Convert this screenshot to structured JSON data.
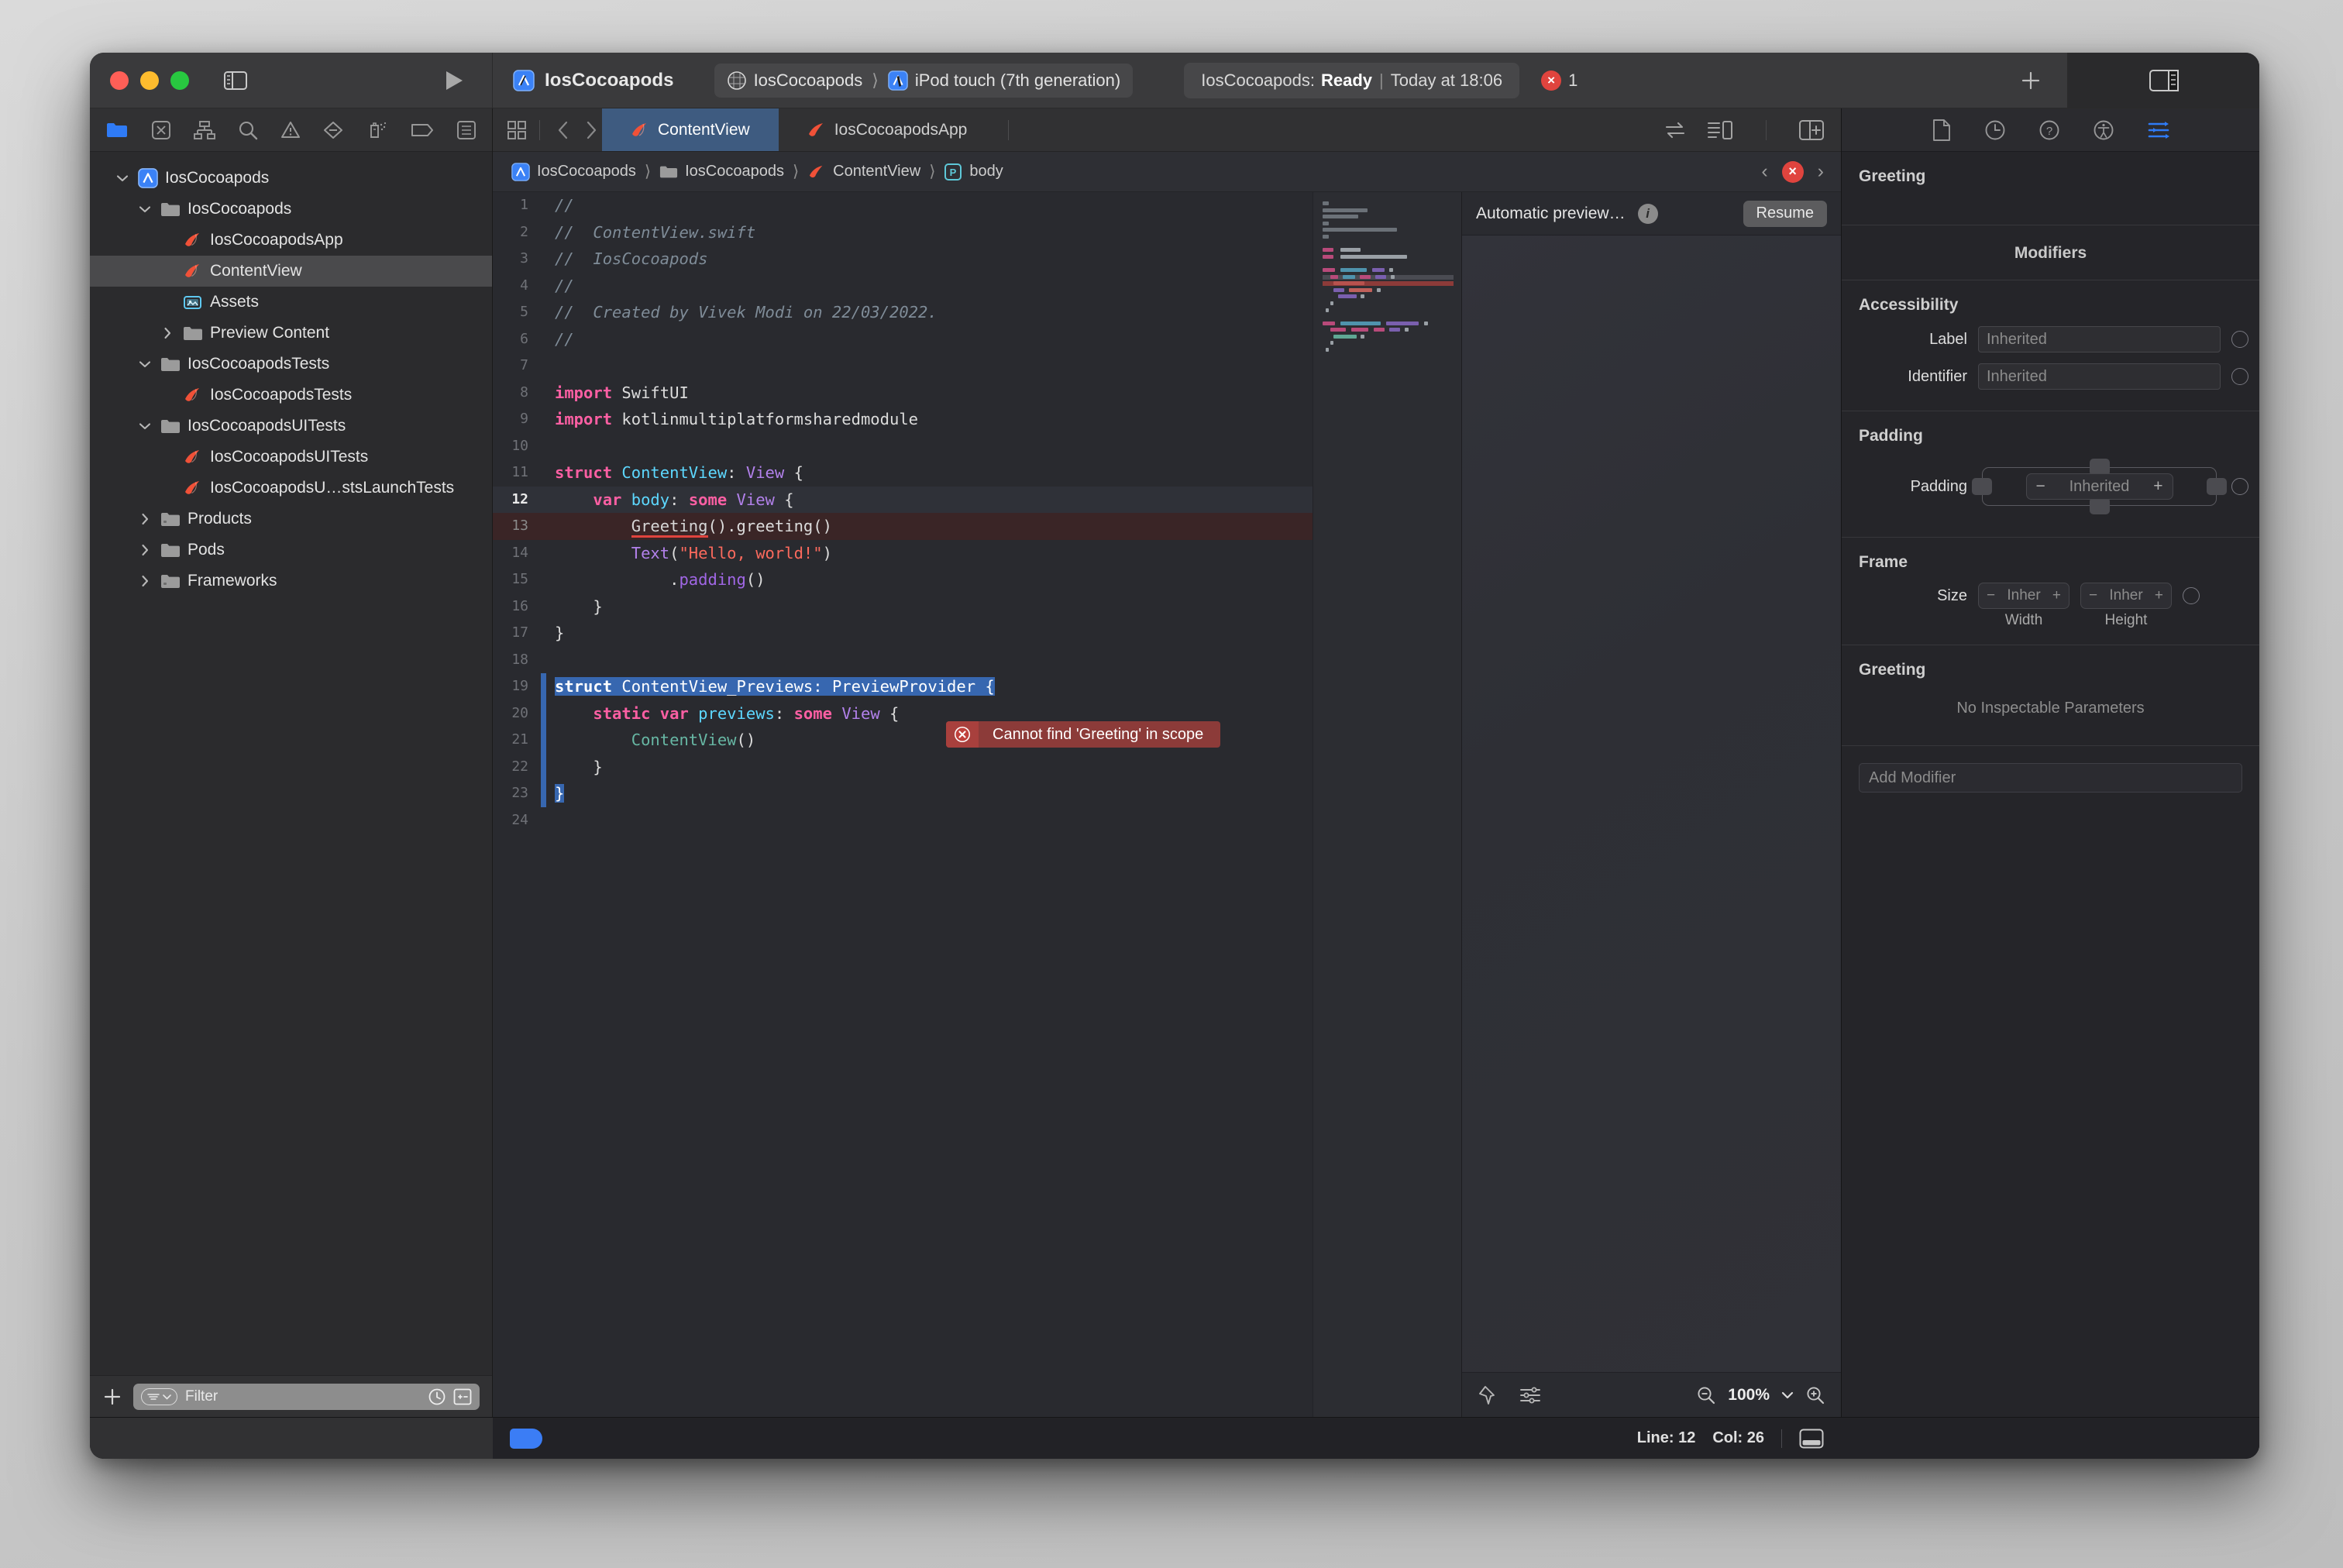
{
  "window": {
    "traffic_lights": [
      "close",
      "minimize",
      "zoom"
    ]
  },
  "toolbar": {
    "project_name": "IosCocoapods",
    "scheme_name": "IosCocoapods",
    "destination": "iPod touch (7th generation)",
    "status_project": "IosCocoapods:",
    "status_state": "Ready",
    "status_divider": "|",
    "status_time": "Today at 18:06",
    "error_count": "1",
    "error_badge_glyph": "×",
    "add_button_glyph": "+"
  },
  "navigator": {
    "icon_bar": [
      {
        "name": "project-navigator-icon",
        "active": true
      },
      {
        "name": "source-control-navigator-icon",
        "active": false
      },
      {
        "name": "symbol-navigator-icon",
        "active": false
      },
      {
        "name": "find-navigator-icon",
        "active": false
      },
      {
        "name": "issue-navigator-icon",
        "active": false
      },
      {
        "name": "test-navigator-icon",
        "active": false
      },
      {
        "name": "debug-navigator-icon",
        "active": false
      },
      {
        "name": "breakpoint-navigator-icon",
        "active": false
      },
      {
        "name": "report-navigator-icon",
        "active": false
      }
    ],
    "tree": [
      {
        "label": "IosCocoapods",
        "indent": 0,
        "twisty": "down",
        "icon": "xcode-project-icon",
        "selected": false
      },
      {
        "label": "IosCocoapods",
        "indent": 1,
        "twisty": "down",
        "icon": "folder-icon",
        "selected": false
      },
      {
        "label": "IosCocoapodsApp",
        "indent": 2,
        "twisty": "none",
        "icon": "swift-file-icon",
        "selected": false
      },
      {
        "label": "ContentView",
        "indent": 2,
        "twisty": "none",
        "icon": "swift-file-icon",
        "selected": true
      },
      {
        "label": "Assets",
        "indent": 2,
        "twisty": "none",
        "icon": "assets-catalog-icon",
        "selected": false
      },
      {
        "label": "Preview Content",
        "indent": 2,
        "twisty": "right",
        "icon": "folder-icon",
        "selected": false
      },
      {
        "label": "IosCocoapodsTests",
        "indent": 1,
        "twisty": "down",
        "icon": "folder-icon",
        "selected": false
      },
      {
        "label": "IosCocoapodsTests",
        "indent": 2,
        "twisty": "none",
        "icon": "swift-file-icon",
        "selected": false
      },
      {
        "label": "IosCocoapodsUITests",
        "indent": 1,
        "twisty": "down",
        "icon": "folder-icon",
        "selected": false
      },
      {
        "label": "IosCocoapodsUITests",
        "indent": 2,
        "twisty": "none",
        "icon": "swift-file-icon",
        "selected": false
      },
      {
        "label": "IosCocoapodsU…stsLaunchTests",
        "indent": 2,
        "twisty": "none",
        "icon": "swift-file-icon",
        "selected": false
      },
      {
        "label": "Products",
        "indent": 1,
        "twisty": "right",
        "icon": "group-folder-icon",
        "selected": false
      },
      {
        "label": "Pods",
        "indent": 1,
        "twisty": "right",
        "icon": "folder-icon",
        "selected": false
      },
      {
        "label": "Frameworks",
        "indent": 1,
        "twisty": "right",
        "icon": "group-folder-icon",
        "selected": false
      }
    ],
    "footer": {
      "add_glyph": "+",
      "filter_placeholder": "Filter"
    }
  },
  "editor": {
    "tabs": [
      {
        "label": "ContentView",
        "active": true
      },
      {
        "label": "IosCocoapodsApp",
        "active": false
      }
    ],
    "breadcrumb": [
      {
        "label": "IosCocoapods",
        "icon": "xcode-project-icon"
      },
      {
        "label": "IosCocoapods",
        "icon": "folder-icon"
      },
      {
        "label": "ContentView",
        "icon": "swift-file-icon"
      },
      {
        "label": "body",
        "icon": "property-icon"
      }
    ],
    "breadcrumb_sep": "›",
    "issue_nav": {
      "prev": "‹",
      "next": "›",
      "badge": "×"
    },
    "code_lines": [
      {
        "n": "1",
        "cur": false,
        "err": false,
        "tokens": [
          {
            "c": "cm",
            "t": "//"
          }
        ]
      },
      {
        "n": "2",
        "cur": false,
        "err": false,
        "tokens": [
          {
            "c": "cm",
            "t": "//  ContentView.swift"
          }
        ]
      },
      {
        "n": "3",
        "cur": false,
        "err": false,
        "tokens": [
          {
            "c": "cm",
            "t": "//  IosCocoapods"
          }
        ]
      },
      {
        "n": "4",
        "cur": false,
        "err": false,
        "tokens": [
          {
            "c": "cm",
            "t": "//"
          }
        ]
      },
      {
        "n": "5",
        "cur": false,
        "err": false,
        "tokens": [
          {
            "c": "cm",
            "t": "//  Created by Vivek Modi on 22/03/2022."
          }
        ]
      },
      {
        "n": "6",
        "cur": false,
        "err": false,
        "tokens": [
          {
            "c": "cm",
            "t": "//"
          }
        ]
      },
      {
        "n": "7",
        "cur": false,
        "err": false,
        "tokens": []
      },
      {
        "n": "8",
        "cur": false,
        "err": false,
        "tokens": [
          {
            "c": "k",
            "t": "import"
          },
          {
            "c": "plain",
            "t": " SwiftUI"
          }
        ]
      },
      {
        "n": "9",
        "cur": false,
        "err": false,
        "tokens": [
          {
            "c": "k",
            "t": "import"
          },
          {
            "c": "plain",
            "t": " kotlinmultiplatformsharedmodule"
          }
        ]
      },
      {
        "n": "10",
        "cur": false,
        "err": false,
        "tokens": []
      },
      {
        "n": "11",
        "cur": false,
        "err": false,
        "tokens": [
          {
            "c": "k",
            "t": "struct"
          },
          {
            "c": "plain",
            "t": " "
          },
          {
            "c": "t",
            "t": "ContentView"
          },
          {
            "c": "plain",
            "t": ": "
          },
          {
            "c": "ty",
            "t": "View"
          },
          {
            "c": "plain",
            "t": " {"
          }
        ]
      },
      {
        "n": "12",
        "cur": true,
        "err": false,
        "tokens": [
          {
            "c": "plain",
            "t": "    "
          },
          {
            "c": "k",
            "t": "var"
          },
          {
            "c": "plain",
            "t": " "
          },
          {
            "c": "t",
            "t": "body"
          },
          {
            "c": "plain",
            "t": ": "
          },
          {
            "c": "k",
            "t": "some"
          },
          {
            "c": "plain",
            "t": " "
          },
          {
            "c": "ty",
            "t": "View"
          },
          {
            "c": "plain",
            "t": " {"
          }
        ]
      },
      {
        "n": "13",
        "cur": false,
        "err": true,
        "tokens": [
          {
            "c": "plain",
            "t": "        "
          },
          {
            "c": "squiggle",
            "t": "Greeting"
          },
          {
            "c": "plain",
            "t": "().greeting()"
          }
        ]
      },
      {
        "n": "14",
        "cur": false,
        "err": false,
        "tokens": [
          {
            "c": "plain",
            "t": "        "
          },
          {
            "c": "ty",
            "t": "Text"
          },
          {
            "c": "plain",
            "t": "("
          },
          {
            "c": "str",
            "t": "\"Hello, world!\""
          },
          {
            "c": "plain",
            "t": ")"
          }
        ]
      },
      {
        "n": "15",
        "cur": false,
        "err": false,
        "tokens": [
          {
            "c": "plain",
            "t": "            ."
          },
          {
            "c": "met",
            "t": "padding"
          },
          {
            "c": "plain",
            "t": "()"
          }
        ]
      },
      {
        "n": "16",
        "cur": false,
        "err": false,
        "tokens": [
          {
            "c": "plain",
            "t": "    }"
          }
        ]
      },
      {
        "n": "17",
        "cur": false,
        "err": false,
        "tokens": [
          {
            "c": "plain",
            "t": "}"
          }
        ]
      },
      {
        "n": "18",
        "cur": false,
        "err": false,
        "tokens": []
      },
      {
        "n": "19",
        "cur": false,
        "err": false,
        "selected": true,
        "tokens": [
          {
            "c": "k sel",
            "t": "struct"
          },
          {
            "c": "sel",
            "t": " "
          },
          {
            "c": "sel",
            "t": "ContentView_Previews"
          },
          {
            "c": "sel",
            "t": ": "
          },
          {
            "c": "sel",
            "t": "PreviewProvider"
          },
          {
            "c": "sel",
            "t": " {"
          }
        ]
      },
      {
        "n": "20",
        "cur": false,
        "err": false,
        "tokens": [
          {
            "c": "plain",
            "t": "    "
          },
          {
            "c": "k",
            "t": "static"
          },
          {
            "c": "plain",
            "t": " "
          },
          {
            "c": "k",
            "t": "var"
          },
          {
            "c": "plain",
            "t": " "
          },
          {
            "c": "t",
            "t": "previews"
          },
          {
            "c": "plain",
            "t": ": "
          },
          {
            "c": "k",
            "t": "some"
          },
          {
            "c": "plain",
            "t": " "
          },
          {
            "c": "ty",
            "t": "View"
          },
          {
            "c": "plain",
            "t": " {"
          }
        ]
      },
      {
        "n": "21",
        "cur": false,
        "err": false,
        "tokens": [
          {
            "c": "plain",
            "t": "        "
          },
          {
            "c": "gt",
            "t": "ContentView"
          },
          {
            "c": "plain",
            "t": "()"
          }
        ]
      },
      {
        "n": "22",
        "cur": false,
        "err": false,
        "tokens": [
          {
            "c": "plain",
            "t": "    }"
          }
        ]
      },
      {
        "n": "23",
        "cur": false,
        "err": false,
        "selected_end": true,
        "tokens": [
          {
            "c": "sel",
            "t": "}"
          }
        ]
      },
      {
        "n": "24",
        "cur": false,
        "err": false,
        "tokens": []
      }
    ],
    "inline_error": {
      "message": "Cannot find 'Greeting' in scope",
      "icon_glyph": "×"
    }
  },
  "preview": {
    "title": "Automatic preview…",
    "info_glyph": "i",
    "resume_label": "Resume",
    "zoom_level": "100%",
    "zoom_chevron": "⌄"
  },
  "inspector": {
    "tabs": [
      {
        "name": "file-inspector-icon",
        "active": false
      },
      {
        "name": "history-inspector-icon",
        "active": false
      },
      {
        "name": "quick-help-inspector-icon",
        "active": false
      },
      {
        "name": "accessibility-inspector-icon",
        "active": false
      },
      {
        "name": "attributes-inspector-icon",
        "active": true
      }
    ],
    "header": "Greeting",
    "modifiers_title": "Modifiers",
    "accessibility": {
      "title": "Accessibility",
      "fields": [
        {
          "label": "Label",
          "placeholder": "Inherited"
        },
        {
          "label": "Identifier",
          "placeholder": "Inherited"
        }
      ]
    },
    "padding": {
      "title": "Padding",
      "field_label": "Padding",
      "value": "Inherited",
      "minus": "−",
      "plus": "+"
    },
    "frame": {
      "title": "Frame",
      "field_label": "Size",
      "width_value": "Inher",
      "height_value": "Inher",
      "width_caption": "Width",
      "height_caption": "Height",
      "minus": "−",
      "plus": "+"
    },
    "greeting_section": {
      "title": "Greeting",
      "empty_text": "No Inspectable Parameters"
    },
    "add_modifier_placeholder": "Add Modifier"
  },
  "status_bar": {
    "line_label": "Line: 12",
    "col_label": "Col: 26"
  },
  "colors": {
    "accent_blue": "#3b7df5",
    "selection_blue": "#3767b0",
    "error_red": "#e0443e",
    "tab_active": "#3e5b80",
    "swift_orange": "#f05138"
  }
}
